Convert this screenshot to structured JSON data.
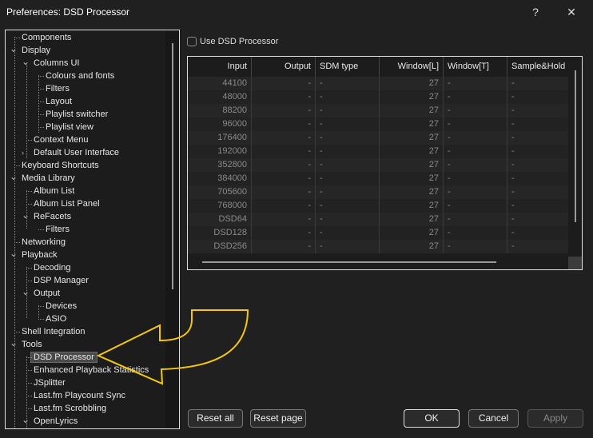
{
  "window": {
    "title": "Preferences: DSD Processor",
    "help": "?",
    "close": "✕"
  },
  "tree": [
    {
      "label": "Components",
      "level": 0,
      "expand": ""
    },
    {
      "label": "Display",
      "level": 0,
      "expand": "open"
    },
    {
      "label": "Columns UI",
      "level": 1,
      "expand": "open"
    },
    {
      "label": "Colours and fonts",
      "level": 2,
      "expand": ""
    },
    {
      "label": "Filters",
      "level": 2,
      "expand": ""
    },
    {
      "label": "Layout",
      "level": 2,
      "expand": ""
    },
    {
      "label": "Playlist switcher",
      "level": 2,
      "expand": ""
    },
    {
      "label": "Playlist view",
      "level": 2,
      "expand": ""
    },
    {
      "label": "Context Menu",
      "level": 1,
      "expand": ""
    },
    {
      "label": "Default User Interface",
      "level": 1,
      "expand": "closed"
    },
    {
      "label": "Keyboard Shortcuts",
      "level": 0,
      "expand": ""
    },
    {
      "label": "Media Library",
      "level": 0,
      "expand": "open"
    },
    {
      "label": "Album List",
      "level": 1,
      "expand": ""
    },
    {
      "label": "Album List Panel",
      "level": 1,
      "expand": ""
    },
    {
      "label": "ReFacets",
      "level": 1,
      "expand": "open"
    },
    {
      "label": "Filters",
      "level": 2,
      "expand": ""
    },
    {
      "label": "Networking",
      "level": 0,
      "expand": ""
    },
    {
      "label": "Playback",
      "level": 0,
      "expand": "open"
    },
    {
      "label": "Decoding",
      "level": 1,
      "expand": ""
    },
    {
      "label": "DSP Manager",
      "level": 1,
      "expand": ""
    },
    {
      "label": "Output",
      "level": 1,
      "expand": "open"
    },
    {
      "label": "Devices",
      "level": 2,
      "expand": ""
    },
    {
      "label": "ASIO",
      "level": 2,
      "expand": ""
    },
    {
      "label": "Shell Integration",
      "level": 0,
      "expand": ""
    },
    {
      "label": "Tools",
      "level": 0,
      "expand": "open"
    },
    {
      "label": "DSD Processor",
      "level": 1,
      "expand": "",
      "selected": true
    },
    {
      "label": "Enhanced Playback Statistics",
      "level": 1,
      "expand": ""
    },
    {
      "label": "JSplitter",
      "level": 1,
      "expand": ""
    },
    {
      "label": "Last.fm Playcount Sync",
      "level": 1,
      "expand": ""
    },
    {
      "label": "Last.fm Scrobbling",
      "level": 1,
      "expand": ""
    },
    {
      "label": "OpenLyrics",
      "level": 1,
      "expand": "open"
    }
  ],
  "use_dsd": {
    "label": "Use DSD Processor",
    "checked": false
  },
  "table": {
    "columns": [
      "Input",
      "Output",
      "SDM type",
      "Window[L]",
      "Window[T]",
      "Sample&Hold"
    ],
    "rows": [
      [
        "44100",
        "-",
        "-",
        "27",
        "-",
        "-"
      ],
      [
        "48000",
        "-",
        "-",
        "27",
        "-",
        "-"
      ],
      [
        "88200",
        "-",
        "-",
        "27",
        "-",
        "-"
      ],
      [
        "96000",
        "-",
        "-",
        "27",
        "-",
        "-"
      ],
      [
        "176400",
        "-",
        "-",
        "27",
        "-",
        "-"
      ],
      [
        "192000",
        "-",
        "-",
        "27",
        "-",
        "-"
      ],
      [
        "352800",
        "-",
        "-",
        "27",
        "-",
        "-"
      ],
      [
        "384000",
        "-",
        "-",
        "27",
        "-",
        "-"
      ],
      [
        "705600",
        "-",
        "-",
        "27",
        "-",
        "-"
      ],
      [
        "768000",
        "-",
        "-",
        "27",
        "-",
        "-"
      ],
      [
        "DSD64",
        "-",
        "-",
        "27",
        "-",
        "-"
      ],
      [
        "DSD128",
        "-",
        "-",
        "27",
        "-",
        "-"
      ],
      [
        "DSD256",
        "-",
        "-",
        "27",
        "-",
        "-"
      ]
    ]
  },
  "buttons": {
    "reset_all": "Reset all",
    "reset_page": "Reset page",
    "ok": "OK",
    "cancel": "Cancel",
    "apply": "Apply"
  },
  "annotation": {
    "arrow_color": "#f5c800"
  }
}
